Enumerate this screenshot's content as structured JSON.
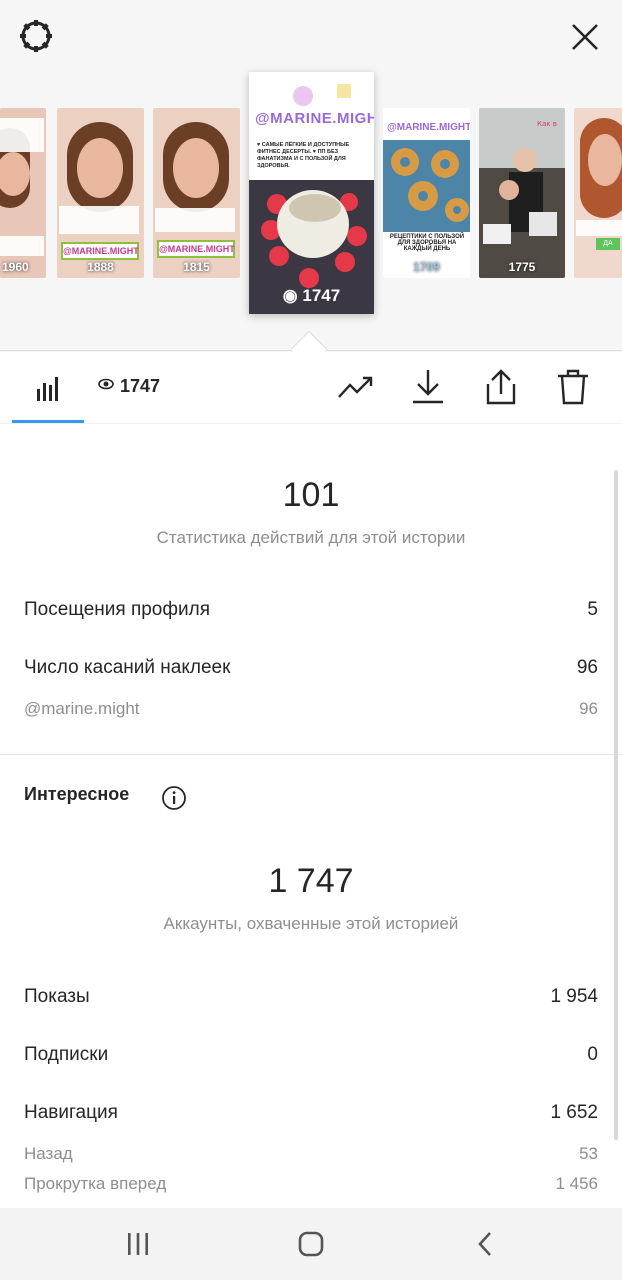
{
  "stories": [
    {
      "views": "1960"
    },
    {
      "views": "1888",
      "handle": "@MARINE.MIGHT"
    },
    {
      "views": "1815",
      "handle": "@MARINE.MIGHT"
    },
    {
      "views": "1747",
      "handle": "@MARINE.MIGHT",
      "text": "♥ САМЫЕ ЛЁГКИЕ И ДОСТУПНЫЕ ФИТНЕС ДЕСЕРТЫ. ♥ ПП БЕЗ ФАНАТИЗМА И С ПОЛЬЗОЙ ДЛЯ ЗДОРОВЬЯ.",
      "selected": true
    },
    {
      "views": "1709",
      "handle": "@MARINE.MIGHT",
      "text": "РЕЦЕПТИКИ С ПОЛЬЗОЙ ДЛЯ ЗДОРОВЬЯ НА КАЖДЫЙ ДЕНЬ"
    },
    {
      "views": "1775"
    },
    {
      "views": ""
    }
  ],
  "toolbar": {
    "views_count": "1747",
    "icons": [
      "insights-bars-icon",
      "eye-icon",
      "trending-icon",
      "download-icon",
      "share-icon",
      "trash-icon"
    ],
    "accent_color": "#3897f0"
  },
  "interactions": {
    "total": "101",
    "caption": "Статистика действий для этой истории",
    "rows": [
      {
        "label": "Посещения профиля",
        "value": "5"
      },
      {
        "label": "Число касаний наклеек",
        "value": "96"
      }
    ],
    "sub_rows": [
      {
        "label": "@marine.might",
        "value": "96"
      }
    ]
  },
  "discovery": {
    "title": "Интересное",
    "reach": "1 747",
    "caption": "Аккаунты, охваченные этой историей",
    "rows": [
      {
        "label": "Показы",
        "value": "1 954"
      },
      {
        "label": "Подписки",
        "value": "0"
      },
      {
        "label": "Навигация",
        "value": "1 652"
      }
    ],
    "sub_rows": [
      {
        "label": "Назад",
        "value": "53"
      },
      {
        "label": "Прокрутка вперед",
        "value": "1 456"
      }
    ]
  },
  "system_nav": {
    "icons": [
      "recent-apps-icon",
      "home-icon",
      "back-icon"
    ]
  }
}
